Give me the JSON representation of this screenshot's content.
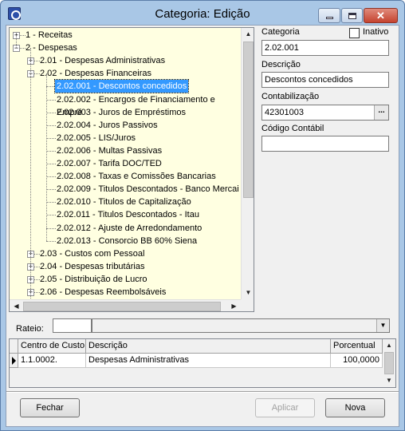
{
  "window": {
    "title": "Categoria: Edição"
  },
  "tree": {
    "items": [
      {
        "label": "1 - Receitas",
        "level": 0,
        "expander": "+"
      },
      {
        "label": "2 - Despesas",
        "level": 0,
        "expander": "-"
      },
      {
        "label": "2.01 - Despesas Administrativas",
        "level": 1,
        "expander": "+"
      },
      {
        "label": "2.02 - Despesas Financeiras",
        "level": 1,
        "expander": "-"
      },
      {
        "label": "2.02.001 - Descontos concedidos",
        "level": 2,
        "selected": true
      },
      {
        "label": "2.02.002 - Encargos de Financiamento e Empré",
        "level": 2
      },
      {
        "label": "2.02.003 - Juros de Empréstimos",
        "level": 2
      },
      {
        "label": "2.02.004 - Juros Passivos",
        "level": 2
      },
      {
        "label": "2.02.005 - LIS/Juros",
        "level": 2
      },
      {
        "label": "2.02.006 - Multas Passivas",
        "level": 2
      },
      {
        "label": "2.02.007 - Tarifa DOC/TED",
        "level": 2
      },
      {
        "label": "2.02.008 - Taxas e Comissões Bancarias",
        "level": 2
      },
      {
        "label": "2.02.009 - Titulos Descontados  - Banco Mercai",
        "level": 2
      },
      {
        "label": "2.02.010 - Titulos de Capitalização",
        "level": 2
      },
      {
        "label": "2.02.011 - Titulos Descontados - Itau",
        "level": 2
      },
      {
        "label": "2.02.012 - Ajuste de Arredondamento",
        "level": 2
      },
      {
        "label": "2.02.013 - Consorcio BB 60% Siena",
        "level": 2
      },
      {
        "label": "2.03 - Custos com Pessoal",
        "level": 1,
        "expander": "+"
      },
      {
        "label": "2.04 - Despesas tributárias",
        "level": 1,
        "expander": "+"
      },
      {
        "label": "2.05 - Distribuição de Lucro",
        "level": 1,
        "expander": "+"
      },
      {
        "label": "2.06 - Despesas Reembolsáveis",
        "level": 1,
        "expander": "+"
      }
    ]
  },
  "form": {
    "categoria_label": "Categoria",
    "inativo_label": "Inativo",
    "categoria_value": "2.02.001",
    "descricao_label": "Descrição",
    "descricao_value": "Descontos concedidos",
    "contabilizacao_label": "Contabilização",
    "contabilizacao_value": "42301003",
    "ellipsis": "...",
    "codigo_label": "Código Contábil",
    "codigo_value": ""
  },
  "rateio": {
    "label": "Rateio:",
    "code_value": "",
    "selected_value": ""
  },
  "grid": {
    "columns": [
      "Centro de Custo",
      "Descrição",
      "Porcentual"
    ],
    "rows": [
      {
        "centro": "1.1.0002.",
        "descricao": "Despesas Administrativas",
        "porcentual": "100,0000"
      }
    ]
  },
  "buttons": {
    "fechar": "Fechar",
    "aplicar": "Aplicar",
    "nova": "Nova"
  }
}
